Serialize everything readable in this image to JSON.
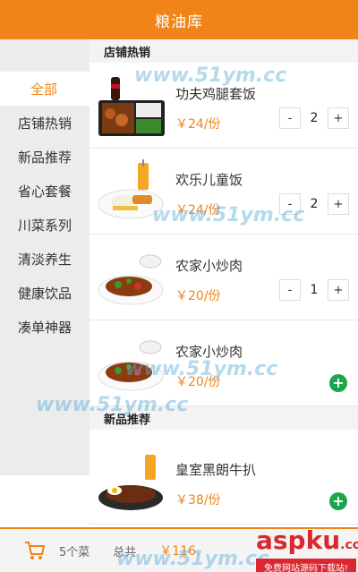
{
  "header": {
    "title": "粮油库"
  },
  "sidebar": {
    "categories": [
      {
        "label": "全部",
        "active": true
      },
      {
        "label": "店铺热销",
        "active": false
      },
      {
        "label": "新品推荐",
        "active": false
      },
      {
        "label": "省心套餐",
        "active": false
      },
      {
        "label": "川菜系列",
        "active": false
      },
      {
        "label": "清淡养生",
        "active": false
      },
      {
        "label": "健康饮品",
        "active": false
      },
      {
        "label": "凑单神器",
        "active": false
      }
    ]
  },
  "sections": [
    {
      "title": "店铺热销",
      "items": [
        {
          "name": "功夫鸡腿套饭",
          "price": "￥24/份",
          "quantity": "2",
          "minus": "-",
          "plus": "+"
        },
        {
          "name": "欢乐儿童饭",
          "price": "￥24/份",
          "quantity": "2",
          "minus": "-",
          "plus": "+"
        },
        {
          "name": "农家小炒肉",
          "price": "￥20/份",
          "quantity": "1",
          "minus": "-",
          "plus": "+"
        },
        {
          "name": "农家小炒肉",
          "price": "￥20/份",
          "add": "+"
        }
      ]
    },
    {
      "title": "新品推荐",
      "items": [
        {
          "name": "皇室黑朗牛扒",
          "price": "￥38/份",
          "add": "+"
        }
      ]
    }
  ],
  "cart": {
    "count_text": "5个菜",
    "total_label": "总共",
    "total_value": "￥116."
  },
  "watermarks": {
    "site": "www.51ym.cc",
    "brand": "aspku",
    "brand_suffix": ".com",
    "brand_slogan": "免费网站源码下载站!"
  },
  "colors": {
    "accent": "#f08418",
    "add_button": "#1aa64a",
    "watermark_red": "#d9282f"
  }
}
